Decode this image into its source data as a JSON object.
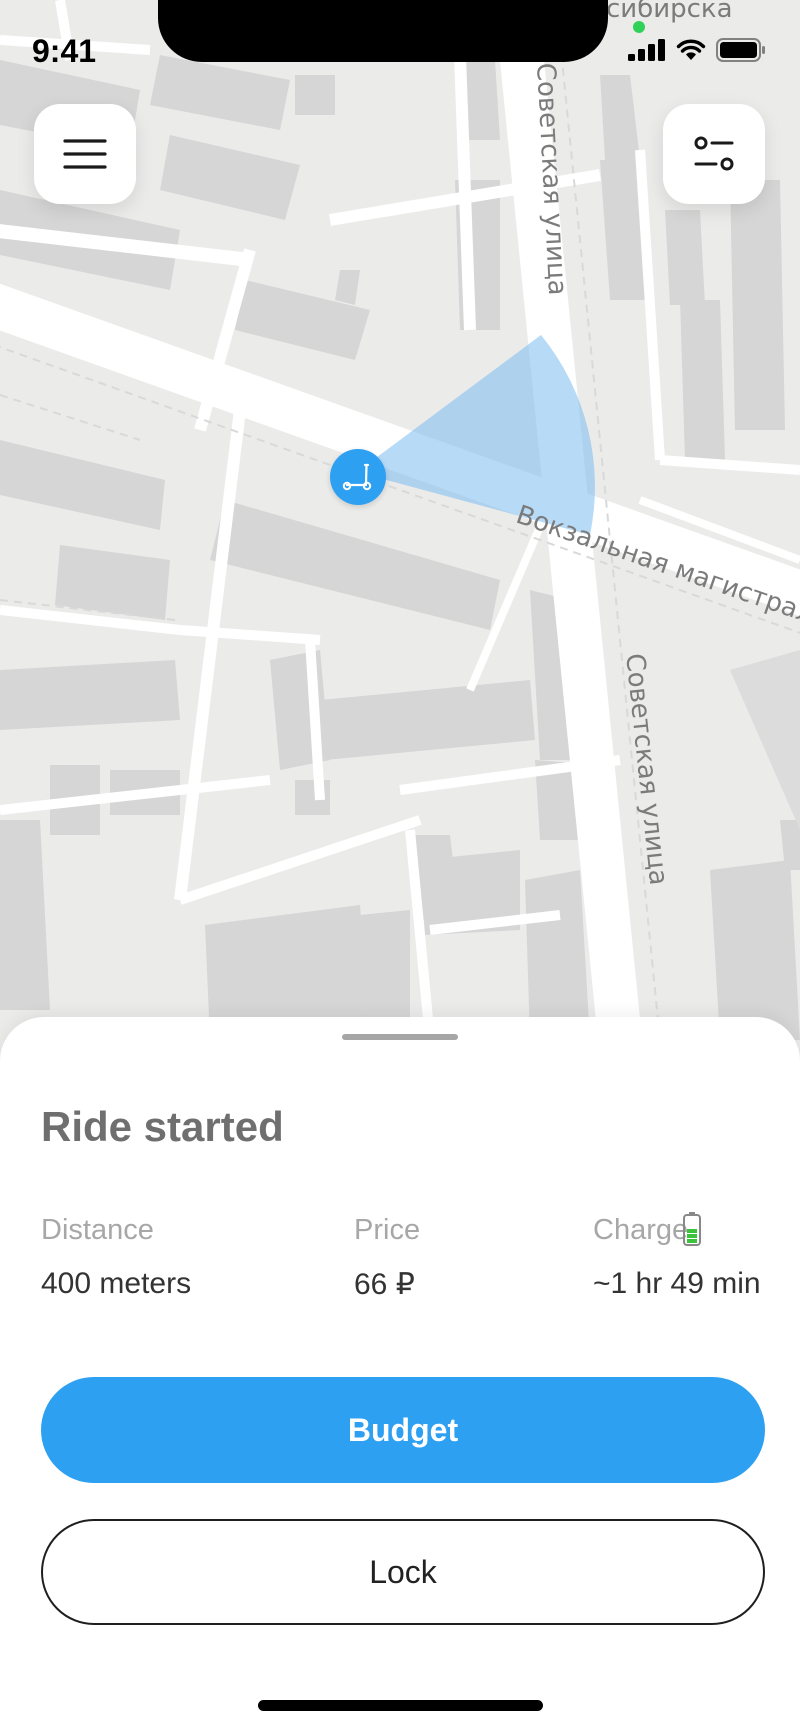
{
  "status_bar": {
    "time": "9:41"
  },
  "map": {
    "street_labels": {
      "top_cut": "сибирска",
      "sovetskaya_top": "Советская улица",
      "vokzalnaya": "Вокзальная магистраль",
      "sovetskaya_bottom": "Советская улица"
    },
    "colors": {
      "pin": "#2ea0f2",
      "cone": "#7bbcf0"
    }
  },
  "header": {
    "menu_icon": "hamburger-icon",
    "filter_icon": "filter-sliders-icon"
  },
  "ride": {
    "title": "Ride started",
    "distance_label": "Distance",
    "distance_value": "400 meters",
    "price_label": "Price",
    "price_value": "66 ₽",
    "charge_label": "Charge",
    "charge_value": "~1 hr 49 min",
    "charge_icon": "battery-icon"
  },
  "actions": {
    "primary_label": "Budget",
    "secondary_label": "Lock"
  },
  "colors": {
    "accent": "#2ea0f2",
    "battery": "#3cc33c"
  }
}
